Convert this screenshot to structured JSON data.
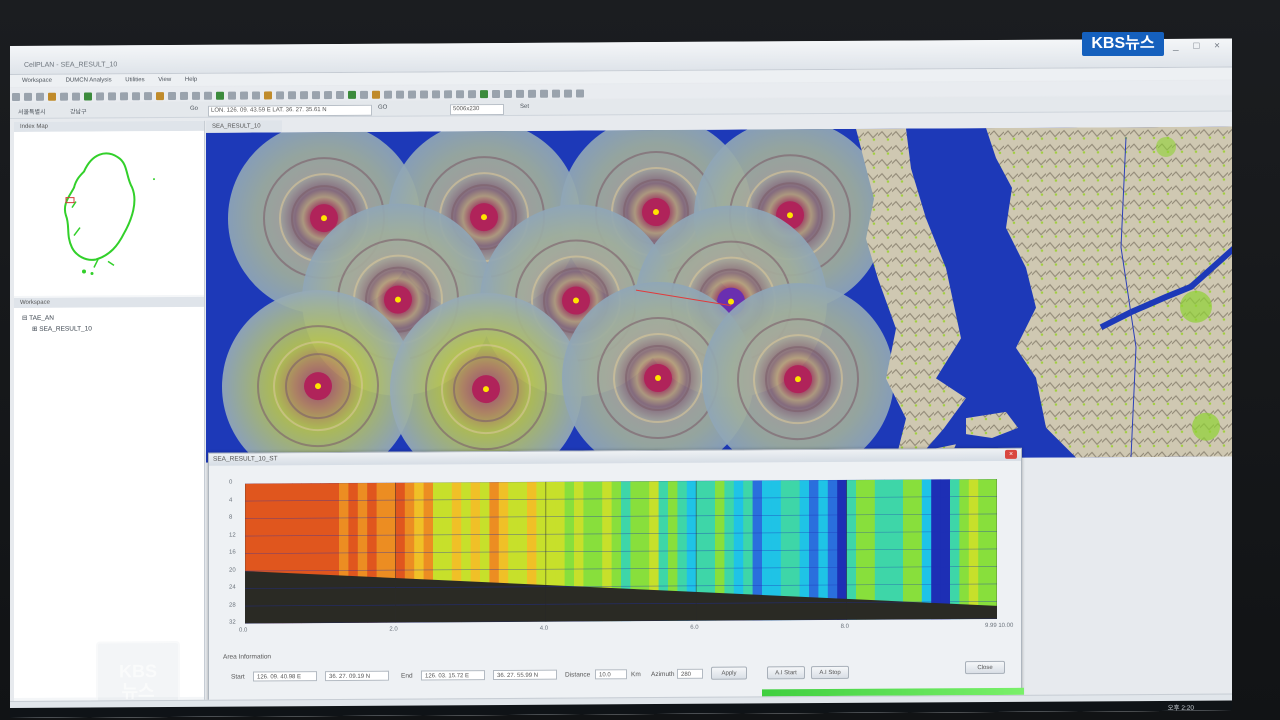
{
  "window": {
    "title": "CellPLAN - SEA_RESULT_10",
    "controls": "_ □ ×"
  },
  "broadcast": {
    "badge": "KBS뉴스",
    "watermark_line1": "KBS",
    "watermark_line2": "뉴스"
  },
  "menu": [
    "Workspace",
    "DUMCN Analysis",
    "Utilities",
    "View",
    "Help"
  ],
  "coordbar": {
    "region": "서울특별시",
    "district": "강남구",
    "go1": "Go",
    "coords": "LON. 126. 09. 43.59 E    LAT. 36. 27. 35.61 N",
    "go2": "GO",
    "scale": "5006x230",
    "set": "Set"
  },
  "leftpanel": {
    "index_map_title": "Index Map",
    "workspace_title": "Workspace",
    "tree": [
      "TAE_AN",
      "SEA_RESULT_10"
    ]
  },
  "map": {
    "tab": "SEA_RESULT_10",
    "sea_color": "#1d39b8",
    "land_color": "#c9c3b0"
  },
  "profile": {
    "title": "SEA_RESULT_10_ST",
    "close": "×",
    "y_ticks": [
      "0",
      "4",
      "8",
      "12",
      "16",
      "20",
      "24",
      "28",
      "32"
    ],
    "x_ticks": [
      "0.0",
      "2.0",
      "4.0",
      "6.0",
      "8.0",
      "9.99 10.00"
    ],
    "area_info_title": "Area Information",
    "start_label": "Start",
    "start_lon": "126. 09. 40.98 E",
    "start_lat": "36. 27. 09.19 N",
    "end_label": "End",
    "end_lon": "126. 03. 15.72 E",
    "end_lat": "36. 27. 55.99 N",
    "distance_label": "Distance",
    "distance_value": "10.0",
    "distance_unit": "Km",
    "azimuth_label": "Azimuth",
    "azimuth_value": "280",
    "apply": "Apply",
    "all_start": "A.I Start",
    "all_stop": "A.I Stop",
    "close_btn": "Close"
  },
  "chart_data": {
    "type": "heatmap",
    "title": "",
    "xlabel": "",
    "ylabel": "",
    "xlim": [
      0,
      10
    ],
    "ylim": [
      32,
      0
    ],
    "x_ticks": [
      0,
      2,
      4,
      6,
      8,
      10
    ],
    "y_ticks": [
      0,
      4,
      8,
      12,
      16,
      20,
      24,
      28,
      32
    ],
    "seabed_depth": {
      "x": [
        0,
        10
      ],
      "y": [
        20,
        29
      ]
    },
    "palette": [
      "#e0561e",
      "#ec8d22",
      "#f0c027",
      "#c7e02b",
      "#88df3c",
      "#3ed6a8",
      "#1fc3e6",
      "#2a6fdd",
      "#1d2fb5"
    ],
    "column_values": [
      0,
      0,
      0,
      0,
      0,
      0,
      0,
      0,
      0,
      0,
      1,
      0,
      1,
      0,
      1,
      1,
      0,
      1,
      2,
      1,
      3,
      3,
      2,
      3,
      2,
      3,
      1,
      2,
      3,
      3,
      2,
      3,
      3,
      3,
      4,
      3,
      4,
      4,
      3,
      4,
      5,
      4,
      4,
      3,
      5,
      4,
      5,
      6,
      5,
      5,
      4,
      5,
      6,
      5,
      7,
      6,
      6,
      5,
      5,
      6,
      7,
      6,
      7,
      8,
      5,
      4,
      4,
      5,
      5,
      5,
      4,
      4,
      6,
      8,
      8,
      5,
      4,
      3,
      4,
      4
    ],
    "grid": true
  }
}
